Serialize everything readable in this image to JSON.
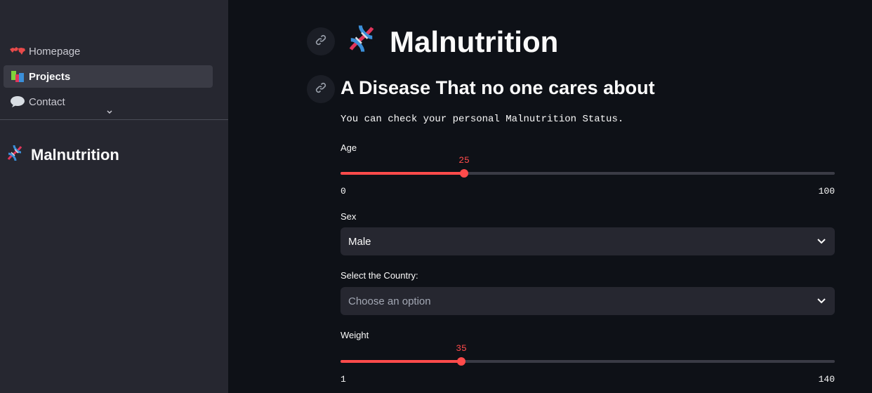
{
  "sidebar": {
    "nav": [
      {
        "label": "Homepage",
        "icon": "world-map-icon",
        "active": false
      },
      {
        "label": "Projects",
        "icon": "books-icon",
        "active": true
      },
      {
        "label": "Contact",
        "icon": "speech-bubble-icon",
        "active": false
      }
    ],
    "title": "Malnutrition"
  },
  "main": {
    "title": "Malnutrition",
    "subtitle": "A Disease That no one cares about",
    "intro": "You can check your personal Malnutrition Status.",
    "age": {
      "label": "Age",
      "value": "25",
      "min": "0",
      "max": "100"
    },
    "sex": {
      "label": "Sex",
      "value": "Male"
    },
    "country": {
      "label": "Select the Country:",
      "placeholder": "Choose an option"
    },
    "weight": {
      "label": "Weight",
      "value": "35",
      "min": "1",
      "max": "140"
    }
  },
  "colors": {
    "accent": "#ff4b4b",
    "background": "#0e1117",
    "sidebar": "#262730"
  }
}
